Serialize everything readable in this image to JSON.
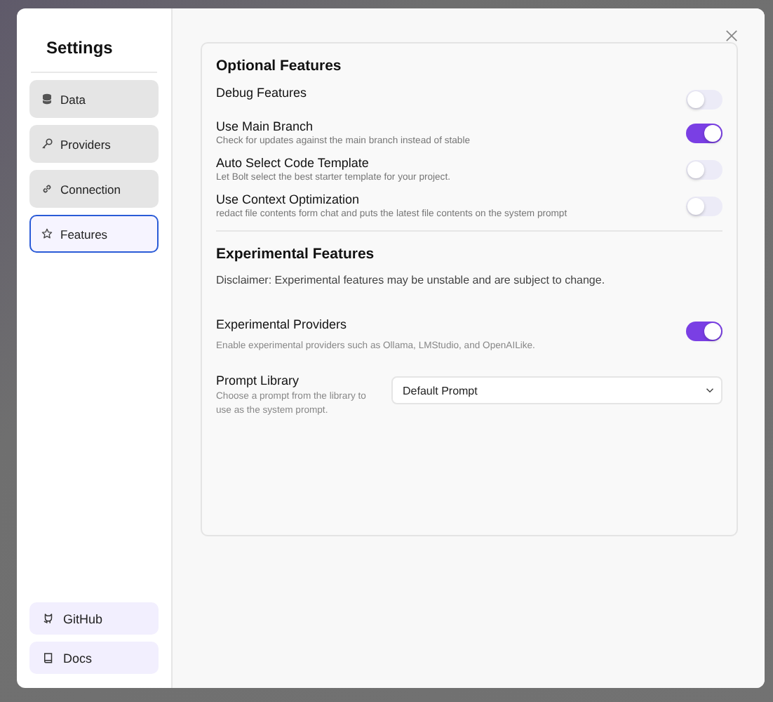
{
  "sidebar": {
    "title": "Settings",
    "tabs": [
      {
        "label": "Data",
        "selected": false
      },
      {
        "label": "Providers",
        "selected": false
      },
      {
        "label": "Connection",
        "selected": false
      },
      {
        "label": "Features",
        "selected": true
      }
    ],
    "links": [
      {
        "label": "GitHub"
      },
      {
        "label": "Docs"
      }
    ]
  },
  "sections": [
    {
      "title": "Optional Features",
      "items": [
        {
          "kind": "toggle",
          "label": "Debug Features",
          "on": false
        },
        {
          "kind": "toggle",
          "label": "Use Main Branch",
          "description": "Check for updates against the main branch instead of stable",
          "on": true
        },
        {
          "kind": "toggle",
          "label": "Auto Select Code Template",
          "description": "Let Bolt select the best starter template for your project.",
          "on": false
        },
        {
          "kind": "toggle",
          "label": "Use Context Optimization",
          "description": "redact file contents form chat and puts the latest file contents on the system prompt",
          "on": false
        }
      ]
    },
    {
      "title": "Experimental Features",
      "disclaimer": "Disclaimer: Experimental features may be unstable and are subject to change.",
      "items": [
        {
          "kind": "toggle",
          "label": "Experimental Providers",
          "description": "Enable experimental providers such as Ollama, LMStudio, and OpenAILike.",
          "on": true
        },
        {
          "kind": "select",
          "label": "Prompt Library",
          "description": "Choose a prompt from the library to use as the system prompt.",
          "value": "Default Prompt"
        }
      ]
    }
  ]
}
